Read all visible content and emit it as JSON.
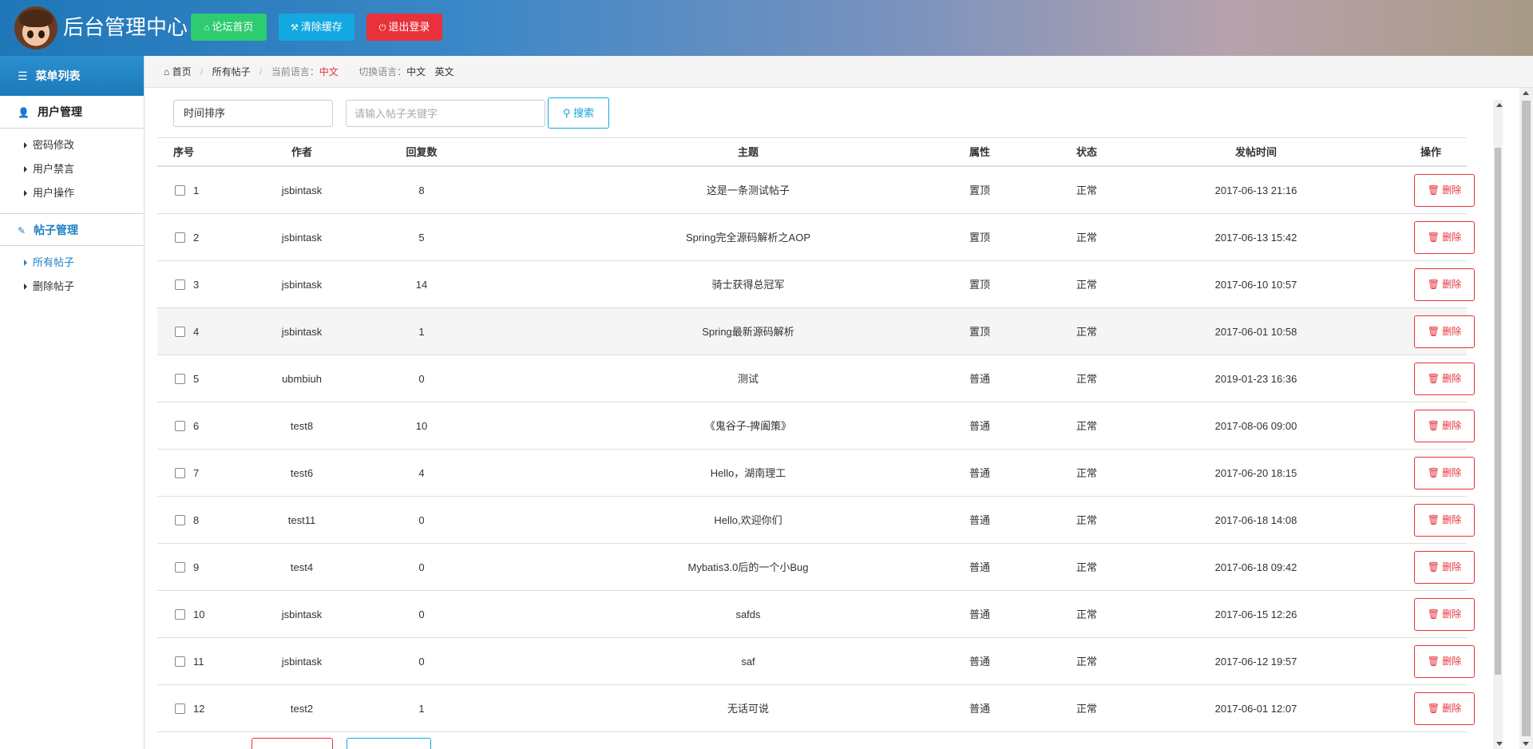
{
  "header": {
    "title": "后台管理中心",
    "buttons": {
      "forum_home": "论坛首页",
      "clear_cache": "清除缓存",
      "logout": "退出登录"
    }
  },
  "sidebar": {
    "menu_title": "菜单列表",
    "groups": [
      {
        "label": "用户管理",
        "items": [
          "密码修改",
          "用户禁言",
          "用户操作"
        ]
      },
      {
        "label": "帖子管理",
        "items": [
          "所有帖子",
          "删除帖子"
        ]
      }
    ],
    "active_item": "所有帖子"
  },
  "breadcrumb": {
    "home": "首页",
    "current": "所有帖子",
    "lang_label": "当前语言：",
    "lang_value": "中文",
    "switch_label": "切换语言：",
    "switch_zh": "中文",
    "switch_en": "英文"
  },
  "toolbar": {
    "sort_value": "时间排序",
    "search_placeholder": "请输入帖子关键字",
    "search_label": "搜索"
  },
  "table": {
    "columns": [
      "序号",
      "作者",
      "回复数",
      "主题",
      "属性",
      "状态",
      "发帖时间",
      "操作"
    ],
    "delete_label": "删除",
    "rows": [
      {
        "idx": "1",
        "author": "jsbintask",
        "replies": "8",
        "topic": "这是一条测试帖子",
        "attr": "置顶",
        "status": "正常",
        "time": "2017-06-13 21:16"
      },
      {
        "idx": "2",
        "author": "jsbintask",
        "replies": "5",
        "topic": "Spring完全源码解析之AOP",
        "attr": "置顶",
        "status": "正常",
        "time": "2017-06-13 15:42"
      },
      {
        "idx": "3",
        "author": "jsbintask",
        "replies": "14",
        "topic": "骑士获得总冠军",
        "attr": "置顶",
        "status": "正常",
        "time": "2017-06-10 10:57"
      },
      {
        "idx": "4",
        "author": "jsbintask",
        "replies": "1",
        "topic": "Spring最新源码解析",
        "attr": "置顶",
        "status": "正常",
        "time": "2017-06-01 10:58"
      },
      {
        "idx": "5",
        "author": "ubmbiuh",
        "replies": "0",
        "topic": "测试",
        "attr": "普通",
        "status": "正常",
        "time": "2019-01-23 16:36"
      },
      {
        "idx": "6",
        "author": "test8",
        "replies": "10",
        "topic": "《鬼谷子-捭阖策》",
        "attr": "普通",
        "status": "正常",
        "time": "2017-08-06 09:00"
      },
      {
        "idx": "7",
        "author": "test6",
        "replies": "4",
        "topic": "Hello，湖南理工",
        "attr": "普通",
        "status": "正常",
        "time": "2017-06-20 18:15"
      },
      {
        "idx": "8",
        "author": "test11",
        "replies": "0",
        "topic": "Hello,欢迎你们",
        "attr": "普通",
        "status": "正常",
        "time": "2017-06-18 14:08"
      },
      {
        "idx": "9",
        "author": "test4",
        "replies": "0",
        "topic": "Mybatis3.0后的一个小Bug",
        "attr": "普通",
        "status": "正常",
        "time": "2017-06-18 09:42"
      },
      {
        "idx": "10",
        "author": "jsbintask",
        "replies": "0",
        "topic": "safds",
        "attr": "普通",
        "status": "正常",
        "time": "2017-06-15 12:26"
      },
      {
        "idx": "11",
        "author": "jsbintask",
        "replies": "0",
        "topic": "saf",
        "attr": "普通",
        "status": "正常",
        "time": "2017-06-12 19:57"
      },
      {
        "idx": "12",
        "author": "test2",
        "replies": "1",
        "topic": "无话可说",
        "attr": "普通",
        "status": "正常",
        "time": "2017-06-01 12:07"
      }
    ]
  },
  "colors": {
    "primary": "#1f82c5",
    "green": "#2ecc71",
    "blue": "#13a8e0",
    "red": "#e8313a"
  }
}
